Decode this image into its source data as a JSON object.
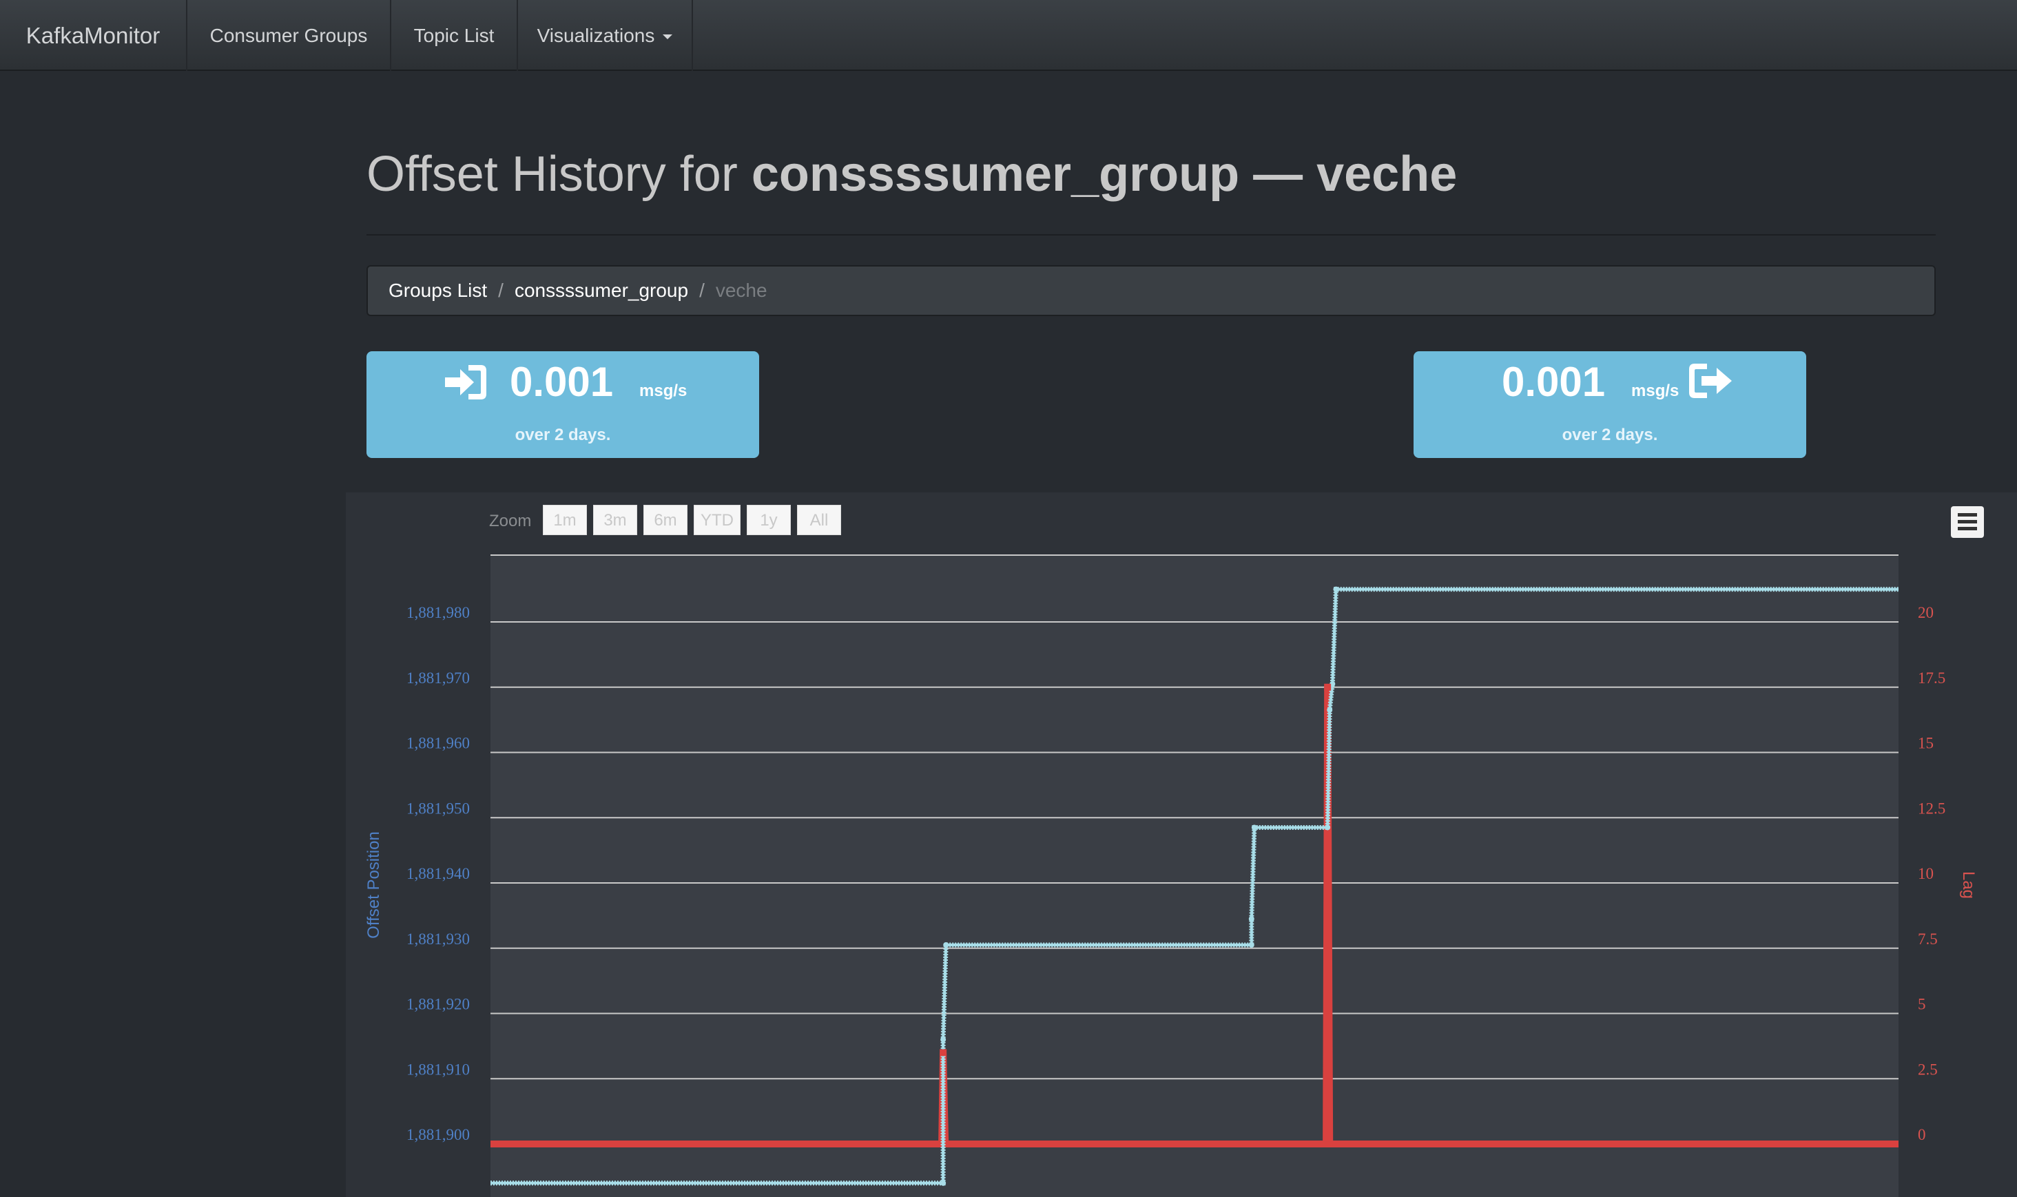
{
  "navbar": {
    "brand": "KafkaMonitor",
    "items": [
      "Consumer Groups",
      "Topic List",
      "Visualizations"
    ]
  },
  "page": {
    "title_prefix": "Offset History for",
    "group": "conssssumer_group",
    "dash": "—",
    "topic": "veche"
  },
  "breadcrumb": [
    "Groups List",
    "conssssumer_group",
    "veche"
  ],
  "rates": {
    "in": {
      "value": "0.001",
      "unit": "msg/s",
      "period": "over 2 days.",
      "icon": "sign-in-icon"
    },
    "out": {
      "value": "0.001",
      "unit": "msg/s",
      "period": "over 2 days.",
      "icon": "sign-out-icon"
    }
  },
  "zoom": {
    "label": "Zoom",
    "buttons": [
      "1m",
      "3m",
      "6m",
      "YTD",
      "1y",
      "All"
    ]
  },
  "colors": {
    "offset_axis": "#4f80c6",
    "lag_axis": "#d9534f",
    "offset_line": "#a8dde8",
    "lag_line": "#d9413f",
    "rate_box": "#6fbcdc"
  },
  "chart_data": {
    "type": "line",
    "left_axis": {
      "label": "Offset Position",
      "ticks": [
        "1,881,900",
        "1,881,910",
        "1,881,920",
        "1,881,930",
        "1,881,940",
        "1,881,950",
        "1,881,960",
        "1,881,970",
        "1,881,980"
      ],
      "range": [
        1881895,
        1881990
      ]
    },
    "right_axis": {
      "label": "Lag",
      "ticks": [
        "0",
        "2.5",
        "5",
        "7.5",
        "10",
        "12.5",
        "15",
        "17.5",
        "20"
      ],
      "range": [
        -0.5,
        22.5
      ]
    },
    "x_range": [
      0,
      1
    ],
    "grid": true,
    "series": [
      {
        "name": "Offset Position",
        "axis": "left",
        "points": [
          [
            0,
            1881894
          ],
          [
            0.3215,
            1881894
          ],
          [
            0.3215,
            1881916
          ],
          [
            0.3235,
            1881930.5
          ],
          [
            0.5405,
            1881930.5
          ],
          [
            0.5405,
            1881934.5
          ],
          [
            0.5425,
            1881948.5
          ],
          [
            0.5945,
            1881948.5
          ],
          [
            0.596,
            1881966.5
          ],
          [
            0.598,
            1881970.5
          ],
          [
            0.6005,
            1881985
          ],
          [
            1,
            1881985
          ]
        ]
      },
      {
        "name": "Lag",
        "axis": "right",
        "points": [
          [
            0,
            0
          ],
          [
            0.3205,
            0
          ],
          [
            0.3215,
            3.5
          ],
          [
            0.323,
            0
          ],
          [
            0.5935,
            0
          ],
          [
            0.5945,
            17.5
          ],
          [
            0.596,
            0
          ],
          [
            1,
            0
          ]
        ]
      }
    ]
  }
}
